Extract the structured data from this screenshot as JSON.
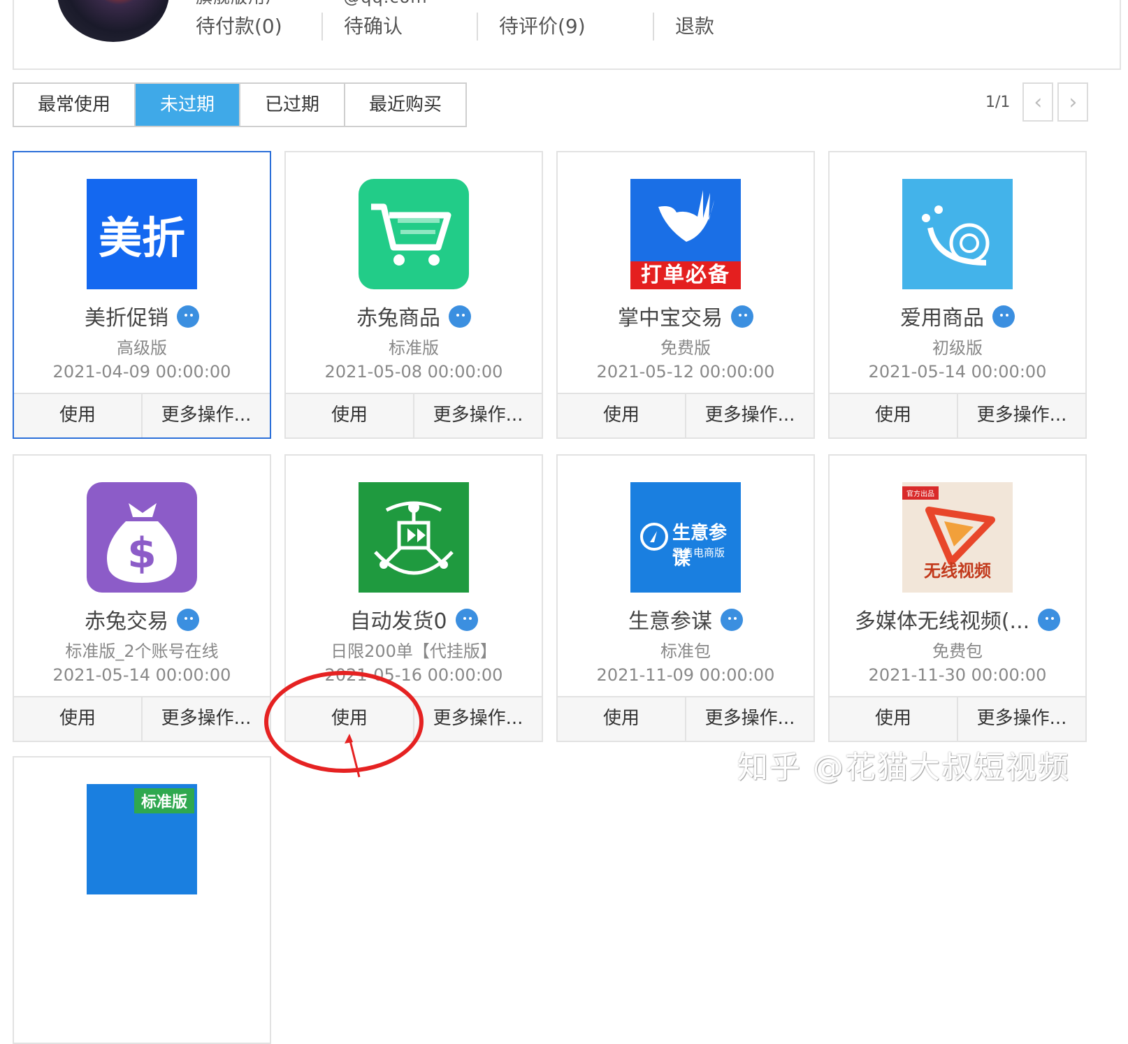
{
  "header": {
    "account": "旗舰版用户 ·········@qq.com",
    "order_tabs": [
      "待付款(0)",
      "待确认",
      "待评价(9)",
      "退款"
    ]
  },
  "filter_tabs": [
    "最常使用",
    "未过期",
    "已过期",
    "最近购买"
  ],
  "active_filter": "未过期",
  "pager": {
    "page": "1/1",
    "prev": "‹",
    "next": "›"
  },
  "cards": [
    {
      "name": "美折促销",
      "edition": "高级版",
      "date": "2021-04-09 00:00:00",
      "use": "使用",
      "more": "更多操作...",
      "logo_text": "美折"
    },
    {
      "name": "赤兔商品",
      "edition": "标准版",
      "date": "2021-05-08 00:00:00",
      "use": "使用",
      "more": "更多操作..."
    },
    {
      "name": "掌中宝交易",
      "edition": "免费版",
      "date": "2021-05-12 00:00:00",
      "use": "使用",
      "more": "更多操作...",
      "logo_text": "打单必备"
    },
    {
      "name": "爱用商品",
      "edition": "初级版",
      "date": "2021-05-14 00:00:00",
      "use": "使用",
      "more": "更多操作..."
    },
    {
      "name": "赤兔交易",
      "edition": "标准版_2个账号在线",
      "date": "2021-05-14 00:00:00",
      "use": "使用",
      "more": "更多操作..."
    },
    {
      "name": "自动发货0",
      "edition": "日限200单【代挂版】",
      "date": "2021-05-16 00:00:00",
      "use": "使用",
      "more": "更多操作..."
    },
    {
      "name": "生意参谋",
      "edition": "标准包",
      "date": "2021-11-09 00:00:00",
      "use": "使用",
      "more": "更多操作...",
      "logo_text": "生意参谋",
      "logo_sub": "零售电商版"
    },
    {
      "name": "多媒体无线视频(...",
      "edition": "免费包",
      "date": "2021-11-30 00:00:00",
      "use": "使用",
      "more": "更多操作...",
      "logo_text": "无线视频",
      "logo_flag": "官方出品"
    },
    {
      "logo_text": "标准版"
    }
  ],
  "watermark": "知乎 @花猫大叔短视频",
  "colors": {
    "accent": "#3fa9e8",
    "selected_border": "#2b6fd8",
    "highlight_ring": "#e52222"
  }
}
